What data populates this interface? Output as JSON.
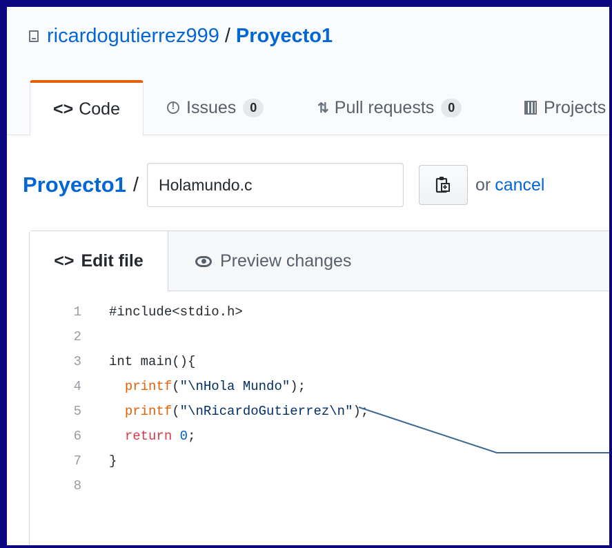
{
  "repo": {
    "owner": "ricardogutierrez999",
    "separator": "/",
    "name": "Proyecto1"
  },
  "nav": {
    "code": {
      "icon": "code-icon",
      "label": "Code"
    },
    "issues": {
      "icon": "issue-opened-icon",
      "label": "Issues",
      "count": "0"
    },
    "pulls": {
      "icon": "git-pull-request-icon",
      "label": "Pull requests",
      "count": "0"
    },
    "projects": {
      "icon": "project-icon",
      "label": "Projects"
    }
  },
  "path": {
    "repo": "Proyecto1",
    "separator": "/",
    "filename": "Holamundo.c",
    "or_text": "or",
    "cancel": "cancel",
    "clipboard_icon": "clippy-icon"
  },
  "editor": {
    "edit_tab": "Edit file",
    "preview_tab": "Preview changes",
    "lines": [
      {
        "n": "1",
        "tokens": [
          {
            "t": "#include<stdio.h>",
            "c": "lc"
          }
        ]
      },
      {
        "n": "2",
        "tokens": []
      },
      {
        "n": "3",
        "tokens": [
          {
            "t": "int main(){",
            "c": "lc"
          }
        ]
      },
      {
        "n": "4",
        "tokens": [
          {
            "t": "  ",
            "c": "lc"
          },
          {
            "t": "printf",
            "c": "fn"
          },
          {
            "t": "(",
            "c": "lc"
          },
          {
            "t": "\"\\nHola Mundo\"",
            "c": "str"
          },
          {
            "t": ");",
            "c": "lc"
          }
        ]
      },
      {
        "n": "5",
        "tokens": [
          {
            "t": "  ",
            "c": "lc"
          },
          {
            "t": "printf",
            "c": "fn"
          },
          {
            "t": "(",
            "c": "lc"
          },
          {
            "t": "\"\\nRicardoGutierrez\\n\"",
            "c": "str"
          },
          {
            "t": ");",
            "c": "lc"
          }
        ]
      },
      {
        "n": "6",
        "tokens": [
          {
            "t": "  ",
            "c": "lc"
          },
          {
            "t": "return",
            "c": "kw"
          },
          {
            "t": " ",
            "c": "lc"
          },
          {
            "t": "0",
            "c": "num"
          },
          {
            "t": ";",
            "c": "lc"
          }
        ]
      },
      {
        "n": "7",
        "tokens": [
          {
            "t": "}",
            "c": "lc"
          }
        ]
      },
      {
        "n": "8",
        "tokens": []
      }
    ]
  },
  "colors": {
    "link": "#0366d6",
    "selected_tab_accent": "#e36209",
    "frame_border": "#0d0880",
    "annotation_line": "#3b6894"
  }
}
